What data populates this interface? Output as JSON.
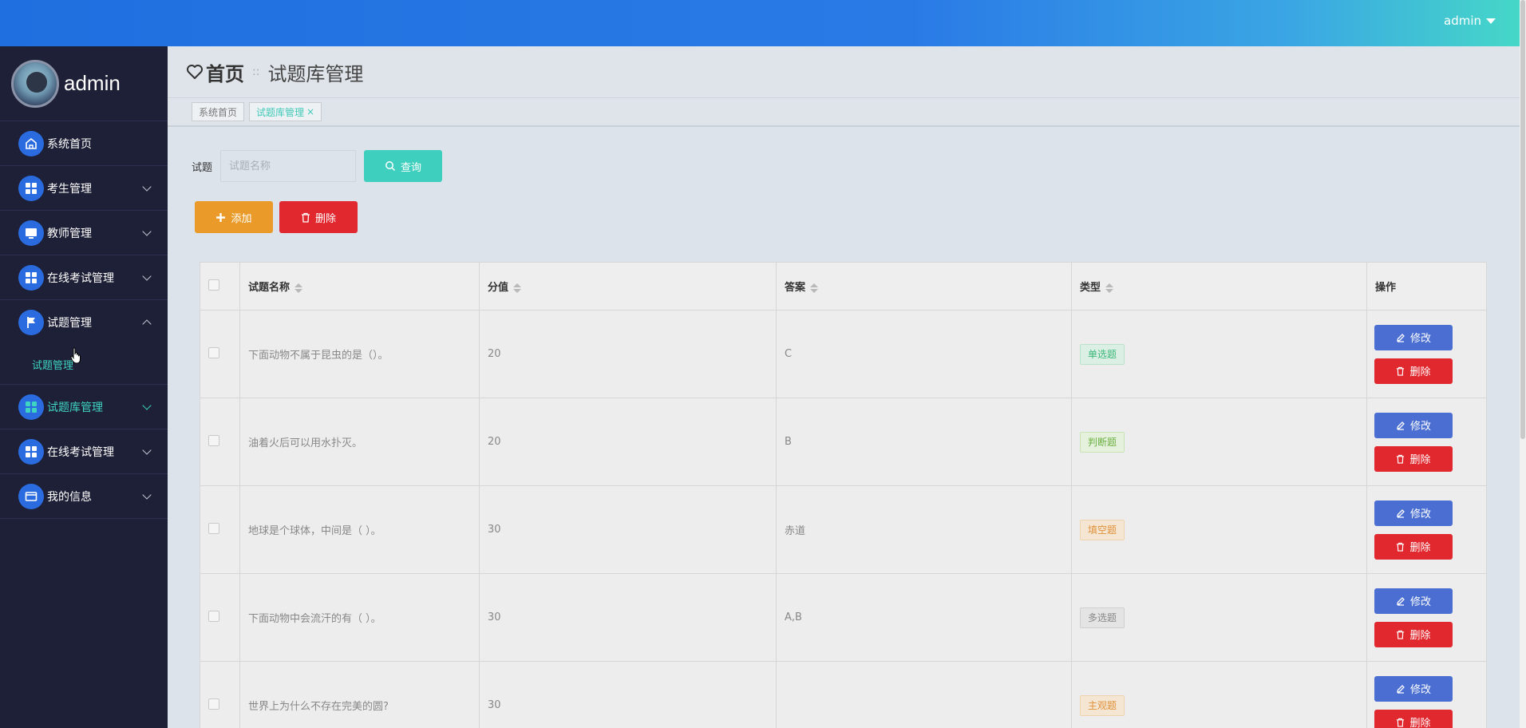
{
  "topbar": {
    "user": "admin"
  },
  "sidebar": {
    "profile_name": "admin",
    "items": [
      {
        "label": "系统首页",
        "icon": "home-icon"
      },
      {
        "label": "考生管理",
        "icon": "grid-icon"
      },
      {
        "label": "教师管理",
        "icon": "monitor-icon"
      },
      {
        "label": "在线考试管理",
        "icon": "grid-icon"
      },
      {
        "label": "试题管理",
        "icon": "flag-icon",
        "expanded": true,
        "sub": [
          {
            "label": "试题管理"
          }
        ]
      },
      {
        "label": "试题库管理",
        "icon": "grid-icon",
        "active": true
      },
      {
        "label": "在线考试管理",
        "icon": "grid-icon"
      },
      {
        "label": "我的信息",
        "icon": "card-icon"
      }
    ]
  },
  "header": {
    "home": "首页",
    "separator": "::",
    "page_title": "试题库管理"
  },
  "tabs": [
    {
      "label": "系统首页"
    },
    {
      "label": "试题库管理",
      "close": "×",
      "active": true
    }
  ],
  "search": {
    "label": "试题",
    "placeholder": "试题名称",
    "button": "查询"
  },
  "actions": {
    "add": "添加",
    "delete": "删除"
  },
  "table": {
    "columns": [
      "试题名称",
      "分值",
      "答案",
      "类型",
      "操作"
    ],
    "rows": [
      {
        "name": "下面动物不属于昆虫的是（）。",
        "score": "20",
        "answer": "C",
        "type": "单选题"
      },
      {
        "name": "油着火后可以用水扑灭。",
        "score": "20",
        "answer": "B",
        "type": "判断题"
      },
      {
        "name": "地球是个球体，中间是（ ）。",
        "score": "30",
        "answer": "赤道",
        "type": "填空题"
      },
      {
        "name": "下面动物中会流汗的有（ ）。",
        "score": "30",
        "answer": "A,B",
        "type": "多选题"
      },
      {
        "name": "世界上为什么不存在完美的圆?",
        "score": "30",
        "answer": "",
        "type": "主观题"
      }
    ],
    "row_actions": {
      "edit": "修改",
      "delete": "删除"
    }
  },
  "colors": {
    "accent": "#3fcfbe",
    "primary": "#2a6cdf",
    "danger": "#e0282e",
    "warning": "#e99a28",
    "edit": "#4a6ed1",
    "sidebar_bg": "#1d2036"
  }
}
